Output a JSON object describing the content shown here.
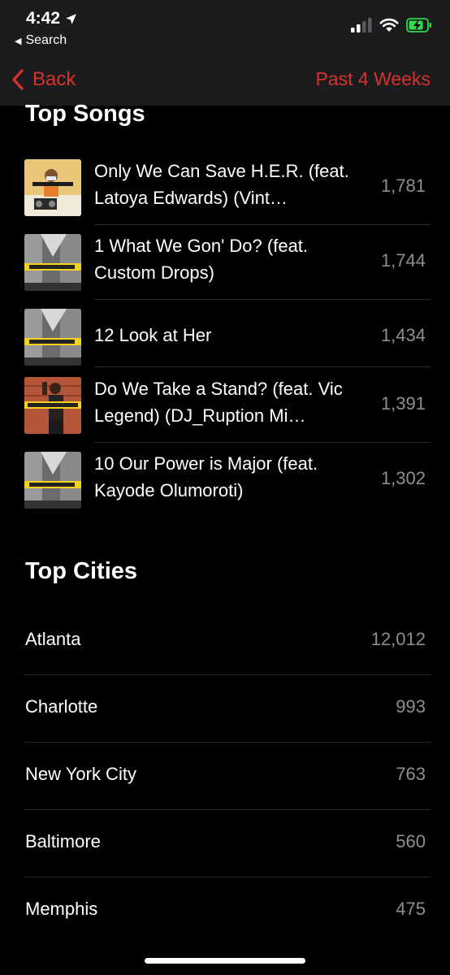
{
  "status": {
    "time": "4:42",
    "back_app_label": "Search"
  },
  "nav": {
    "back_label": "Back",
    "period_label": "Past 4 Weeks"
  },
  "top_songs": {
    "title": "Top Songs",
    "items": [
      {
        "title": "Only We Can Save H.E.R. (feat. Latoya Edwards) (Vint…",
        "count": "1,781"
      },
      {
        "title": "1 What We Gon' Do? (feat. Custom Drops)",
        "count": "1,744"
      },
      {
        "title": "12 Look at Her",
        "count": "1,434"
      },
      {
        "title": "Do We Take a Stand? (feat. Vic Legend) (DJ_Ruption Mi…",
        "count": "1,391"
      },
      {
        "title": "10 Our Power is Major (feat. Kayode Olumoroti)",
        "count": "1,302"
      }
    ]
  },
  "top_cities": {
    "title": "Top Cities",
    "items": [
      {
        "name": "Atlanta",
        "count": "12,012"
      },
      {
        "name": "Charlotte",
        "count": "993"
      },
      {
        "name": "New York City",
        "count": "763"
      },
      {
        "name": "Baltimore",
        "count": "560"
      },
      {
        "name": "Memphis",
        "count": "475"
      }
    ]
  },
  "colors": {
    "accent": "#d7322e",
    "secondary_text": "#8e8e93",
    "bar_background": "#1c1c1e",
    "background": "#000000",
    "battery_charging": "#32d74b"
  },
  "icons": {
    "location": "location-arrow-icon",
    "back_app": "back-triangle-icon",
    "signal": "cellular-signal-icon",
    "wifi": "wifi-icon",
    "battery": "battery-charging-icon",
    "back": "chevron-left-icon"
  }
}
